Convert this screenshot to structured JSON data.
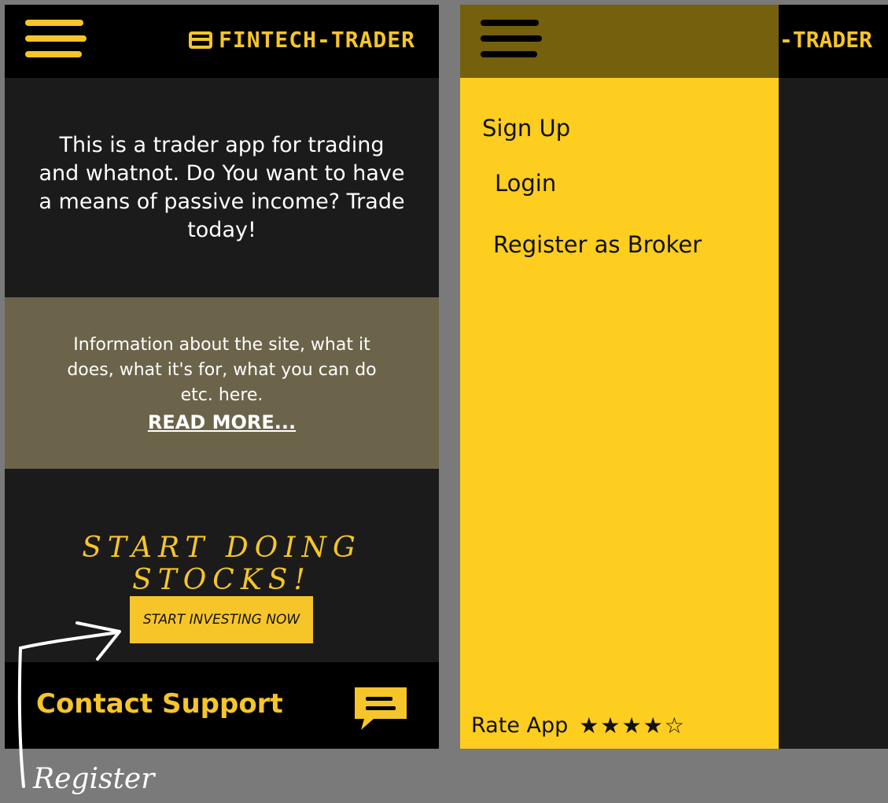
{
  "home": {
    "brand": "FINTECH-TRADER",
    "hero_text": "This is a trader app for trading and whatnot. Do You want to have a means of passive income? Trade today!",
    "info_text": "Information about the site, what it does, what it's for, what you can do etc. here.",
    "read_more": "READ MORE...",
    "cta_heading": "START DOING STOCKS!",
    "cta_button": "START INVESTING NOW",
    "contact_support": "Contact Support",
    "annotation": "Register"
  },
  "menu": {
    "brand_visible": "-TRADER",
    "items": [
      "Sign Up",
      "Login",
      "Register as Broker"
    ],
    "rate_label": "Rate App",
    "stars": [
      "★",
      "★",
      "★",
      "★",
      "☆"
    ]
  },
  "colors": {
    "accent": "#f6c52a",
    "drawer": "#fdcd1f",
    "info_band": "#6b644a",
    "background": "#1b1b1b"
  }
}
